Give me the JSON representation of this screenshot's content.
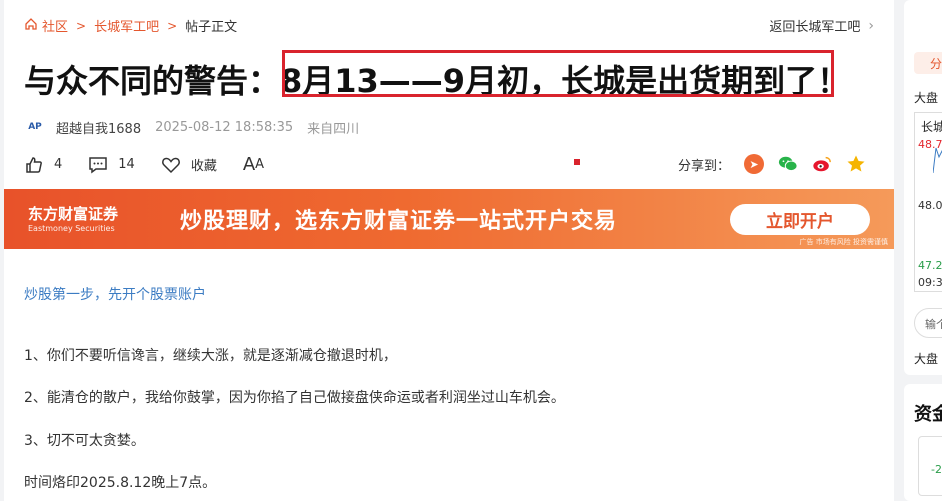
{
  "breadcrumb": {
    "home": "社区",
    "bar": "长城军工吧",
    "current": "帖子正文",
    "back": "返回长城军工吧"
  },
  "post": {
    "title": "与众不同的警告：8月13——9月初，长城是出货期到了！",
    "author": "超越自我1688",
    "time": "2025-08-12 18:58:35",
    "location": "来自四川",
    "avatar_text": "AP",
    "likes": "4",
    "comments": "14",
    "favorite": "收藏",
    "font_label_big": "A",
    "font_label_small": "A",
    "share_label": "分享到：",
    "body": [
      "炒股第一步，先开个股票账户",
      "1、你们不要听信谗言，继续大涨，就是逐渐减仓撤退时机，",
      "2、能清仓的散户，我给你鼓掌，因为你掐了自己做接盘侠命运或者利润坐过山车机会。",
      "3、切不可太贪婪。",
      "时间烙印2025.8.12晚上7点。"
    ]
  },
  "banner": {
    "brand_cn": "东方财富证券",
    "brand_en": "Eastmoney Securities",
    "slogan": "炒股理财，选东方财富证券一站式开户交易",
    "button": "立即开户",
    "ad_note": "广告 市场有风险 投资需谨慎"
  },
  "sidebar": {
    "tag": "分",
    "label1": "大盘",
    "stock": "长城",
    "p1": "48.7",
    "p2": "48.0",
    "p3": "47.2",
    "time": "09:3",
    "input": "输个",
    "label2": "大盘",
    "section": "资金",
    "num": "-2("
  },
  "colors": {
    "accent": "#e4572e",
    "highlight_box": "#d9232d",
    "link": "#3c7cc3"
  }
}
